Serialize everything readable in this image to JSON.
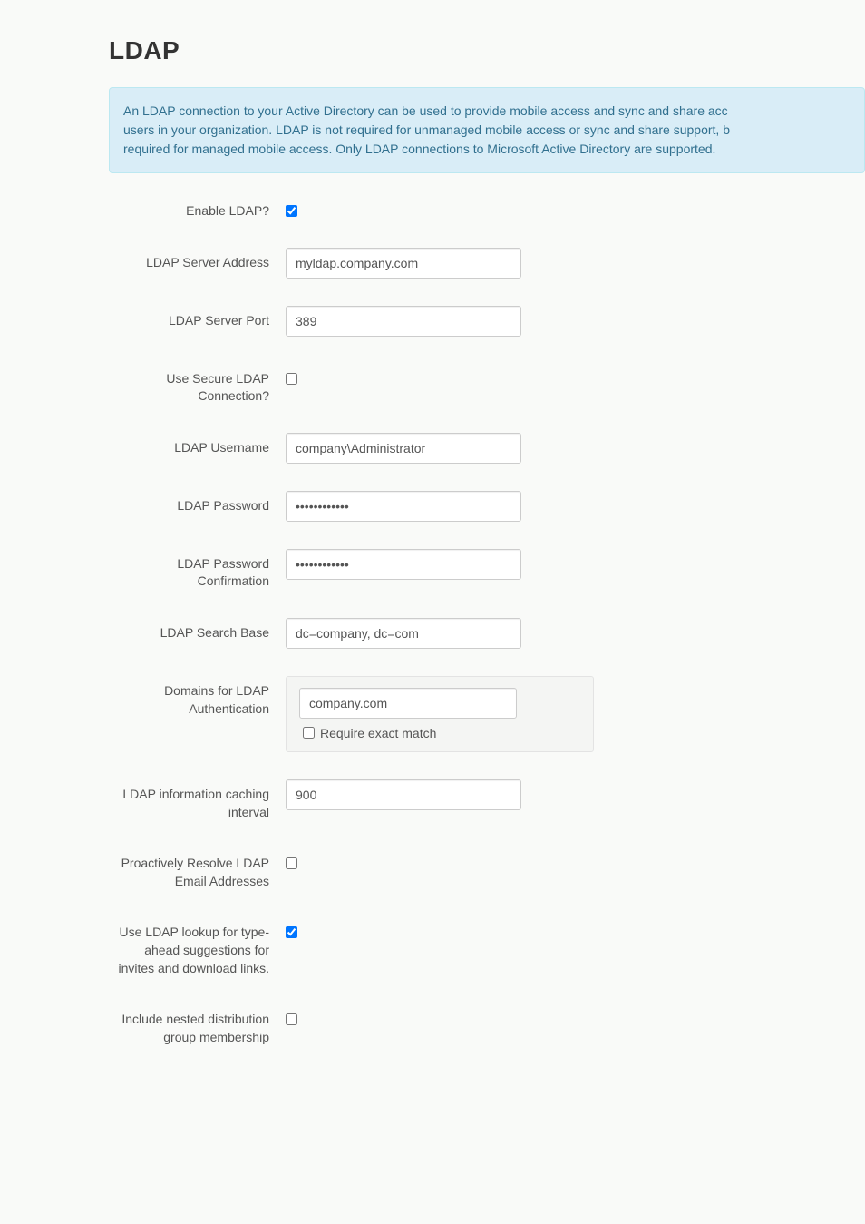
{
  "page": {
    "title": "LDAP"
  },
  "info_banner": {
    "line1": "An LDAP connection to your Active Directory can be used to provide mobile access and sync and share acc",
    "line2": "users in your organization. LDAP is not required for unmanaged mobile access or sync and share support, b",
    "line3": "required for managed mobile access. Only LDAP connections to Microsoft Active Directory are supported."
  },
  "fields": {
    "enable_ldap": {
      "label": "Enable LDAP?",
      "checked": true
    },
    "server_address": {
      "label": "LDAP Server Address",
      "value": "myldap.company.com"
    },
    "server_port": {
      "label": "LDAP Server Port",
      "value": "389"
    },
    "secure_connection": {
      "label": "Use Secure LDAP Connection?",
      "checked": false
    },
    "username": {
      "label": "LDAP Username",
      "value": "company\\Administrator"
    },
    "password": {
      "label": "LDAP Password",
      "value": "************"
    },
    "password_confirm": {
      "label": "LDAP Password Confirmation",
      "value": "************"
    },
    "search_base": {
      "label": "LDAP Search Base",
      "value": "dc=company, dc=com"
    },
    "domains": {
      "label": "Domains for LDAP Authentication",
      "value": "company.com",
      "exact_match_label": "Require exact match",
      "exact_match_checked": false
    },
    "caching_interval": {
      "label": "LDAP information caching interval",
      "value": "900"
    },
    "proactive_resolve": {
      "label": "Proactively Resolve LDAP Email Addresses",
      "checked": false
    },
    "typeahead": {
      "label": "Use LDAP lookup for type-ahead suggestions for invites and download links.",
      "checked": true
    },
    "nested_groups": {
      "label": "Include nested distribution group membership",
      "checked": false
    }
  }
}
